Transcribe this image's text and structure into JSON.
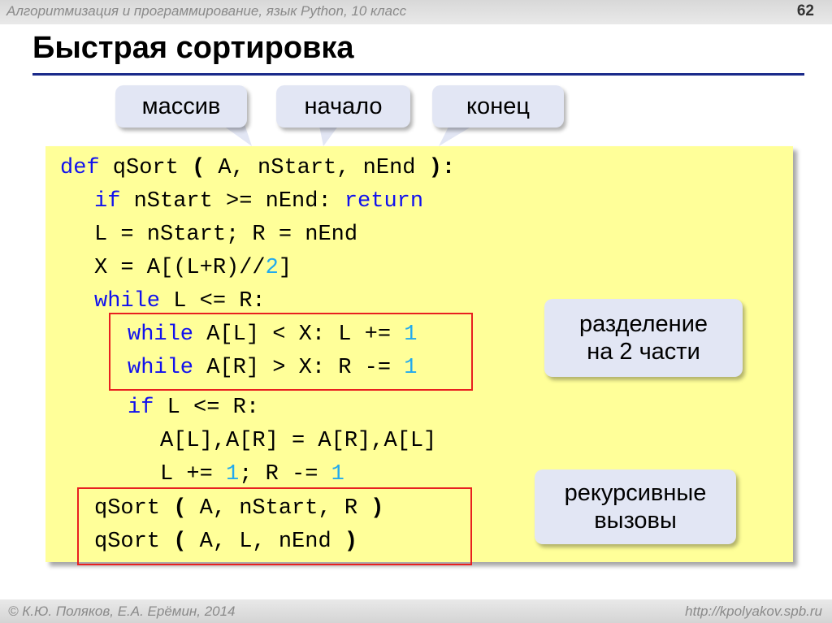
{
  "header": {
    "course": "Алгоритмизация и программирование, язык Python, 10 класс",
    "page_number": "62"
  },
  "title": "Быстрая сортировка",
  "callouts": {
    "array": "массив",
    "start": "начало",
    "end": "конец",
    "partition_1": "разделение",
    "partition_2": "на 2 части",
    "recursive_1": "рекурсивные",
    "recursive_2": "вызовы"
  },
  "code": {
    "def": "def",
    "def_rest": " qSort ",
    "paren_open": "(",
    "def_args": " A, nStart, nEnd ",
    "def_close": "):",
    "if1": "if",
    "if1_rest": " nStart >= nEnd: ",
    "return": "return",
    "assign_lr": "L = nStart; R = nEnd",
    "x_pre": "X = A[(L+R)//",
    "x_two": "2",
    "x_post": "]",
    "while_outer": "while",
    "while_outer_rest": " L <= R:",
    "wl": "while",
    "wl_rest": " A[L] < X: L += ",
    "wl_num": "1",
    "wr": "while",
    "wr_rest": " A[R] > X: R -= ",
    "wr_num": "1",
    "if2": "if",
    "if2_rest": " L <= R:",
    "swap": "A[L],A[R] = A[R],A[L]",
    "inc_a": "L += ",
    "inc_a_num": "1",
    "inc_b": "; R -= ",
    "inc_b_num": "1",
    "rec1_a": "qSort ",
    "rec1_p1": "(",
    "rec1_args": " A, nStart, R ",
    "rec1_p2": ")",
    "rec2_a": "qSort ",
    "rec2_p1": "(",
    "rec2_args": " A, L, nEnd ",
    "rec2_p2": ")"
  },
  "footer": {
    "author": "© К.Ю. Поляков, Е.А. Ерёмин, 2014",
    "url": "http://kpolyakov.spb.ru"
  },
  "colors": {
    "keyword": "#1111ee",
    "number": "#22aaee",
    "code_bg": "#ffff99",
    "callout_bg": "#e2e6f4",
    "highlight": "#e82020",
    "rule": "#1a2a8a"
  }
}
